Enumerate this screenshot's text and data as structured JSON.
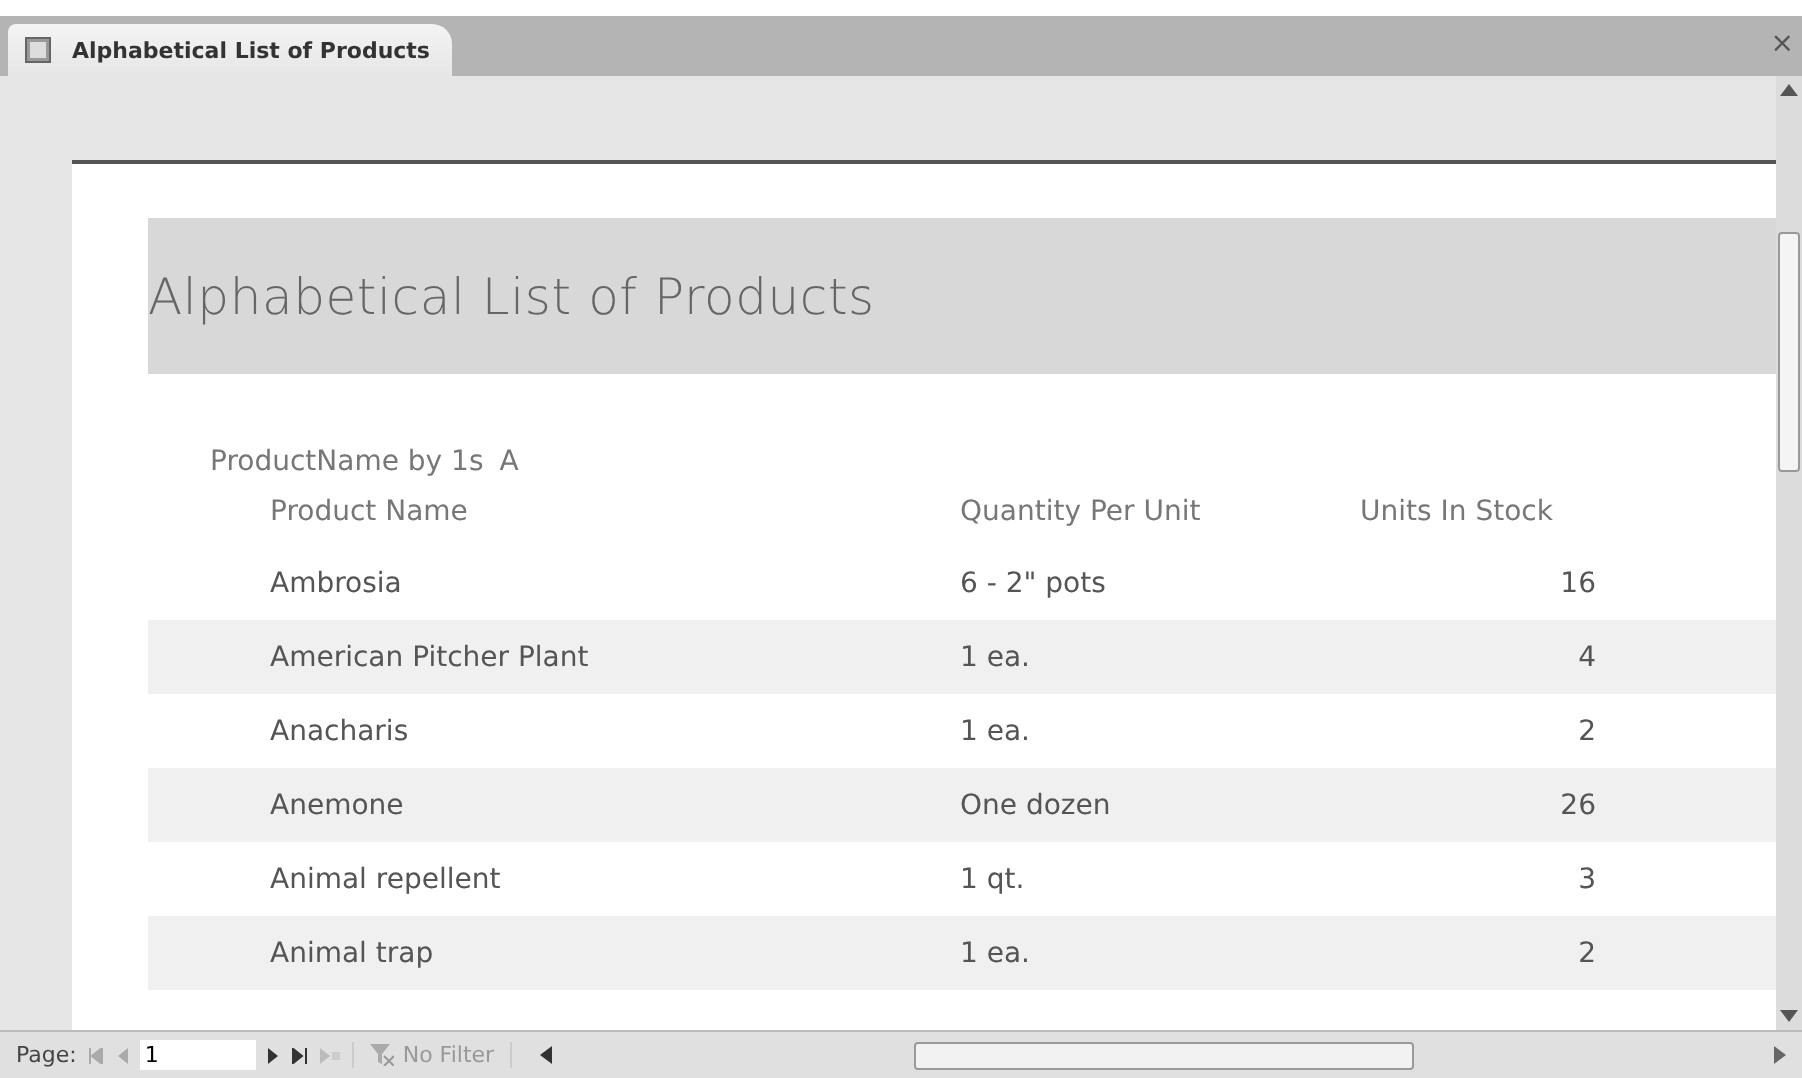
{
  "tab": {
    "title": "Alphabetical List of Products",
    "close": "×"
  },
  "report": {
    "title": "Alphabetical List of Products",
    "group_label": "ProductName by 1s",
    "group_value": "A",
    "columns": [
      "Product Name",
      "Quantity Per Unit",
      "Units In Stock"
    ],
    "rows": [
      {
        "product": "Ambrosia",
        "quantity": "6 - 2\" pots",
        "stock": "16"
      },
      {
        "product": "American Pitcher Plant",
        "quantity": "1 ea.",
        "stock": "4"
      },
      {
        "product": "Anacharis",
        "quantity": "1 ea.",
        "stock": "2"
      },
      {
        "product": "Anemone",
        "quantity": "One dozen",
        "stock": "26"
      },
      {
        "product": "Animal repellent",
        "quantity": "1 qt.",
        "stock": "3"
      },
      {
        "product": "Animal trap",
        "quantity": "1 ea.",
        "stock": "2"
      }
    ]
  },
  "navigation": {
    "page_label": "Page:",
    "page_number": "1",
    "filter": "No Filter"
  }
}
